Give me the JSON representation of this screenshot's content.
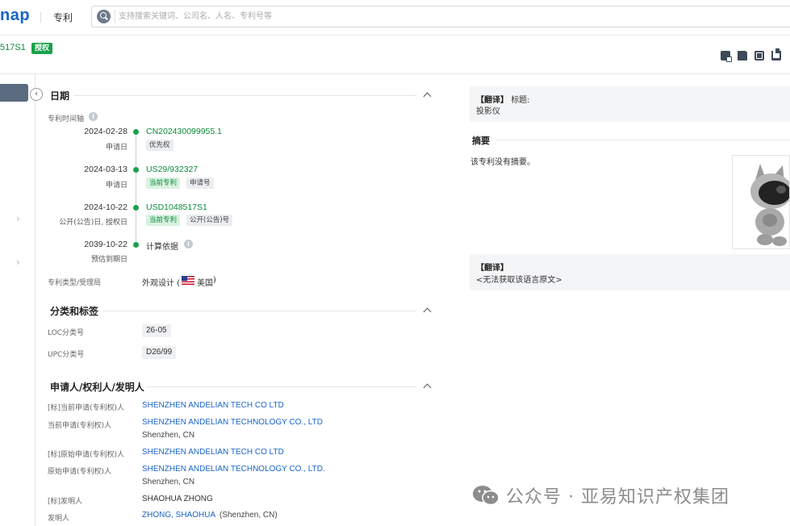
{
  "topbar": {
    "logo": "nap",
    "nav_patent": "专利",
    "search_placeholder": "支持搜索关键词、公司名、人名、专利号等"
  },
  "header": {
    "pub_no": "517S1",
    "status": "授权"
  },
  "dates": {
    "title": "日期",
    "timeline_label": "专利时间轴",
    "events": [
      {
        "date": "2024-02-28",
        "sub": "申请日",
        "link": "CN202430099955.1",
        "tags": [
          "优先权"
        ]
      },
      {
        "date": "2024-03-13",
        "sub": "申请日",
        "link": "US29/932327",
        "tags": [
          "当前专利",
          "申请号"
        ]
      },
      {
        "date": "2024-10-22",
        "sub": "公开(公告)日, 授权日",
        "link": "USD1048517S1",
        "tags": [
          "当前专利",
          "公开(公告)号"
        ]
      },
      {
        "date": "2039-10-22",
        "sub": "预估到期日",
        "link": "计算依据",
        "tags": []
      }
    ],
    "type_label": "专利类型/受理局",
    "type_value": "外观设计 (",
    "country": "美国",
    "type_close": ")"
  },
  "classification": {
    "title": "分类和标签",
    "loc_label": "LOC分类号",
    "loc_value": "26-05",
    "upc_label": "UPC分类号",
    "upc_value": "D26/99"
  },
  "parties": {
    "title": "申请人/权利人/发明人",
    "rows": [
      {
        "label": "[标]当前申请(专利权)人",
        "value": "SHENZHEN ANDELIAN TECH CO LTD"
      },
      {
        "label": "当前申请(专利权)人",
        "value": "SHENZHEN ANDELIAN TECHNOLOGY CO., LTD",
        "sub": "Shenzhen, CN"
      },
      {
        "label": "[标]原始申请(专利权)人",
        "value": "SHENZHEN ANDELIAN TECH CO LTD"
      },
      {
        "label": "原始申请(专利权)人",
        "value": "SHENZHEN ANDELIAN TECHNOLOGY CO., LTD.",
        "sub": "Shenzhen, CN"
      },
      {
        "label": "[标]发明人",
        "value": "SHAOHUA ZHONG"
      },
      {
        "label": "发明人",
        "value": "ZHONG, SHAOHUA",
        "extra": "(Shenzhen, CN)"
      }
    ]
  },
  "right": {
    "translate_tag": "【翻译】",
    "title_label": "标题:",
    "title_value": "投影仪",
    "abstract_title": "摘要",
    "abstract_text": "该专利没有摘要。",
    "translate_tag2": "【翻译】",
    "no_original": "<无法获取该语言原文>"
  },
  "watermark": {
    "text": "公众号 · 亚易知识产权集团"
  },
  "colors": {
    "brand": "#1a64c8",
    "green": "#1aa14a",
    "link": "#1a64c8"
  }
}
